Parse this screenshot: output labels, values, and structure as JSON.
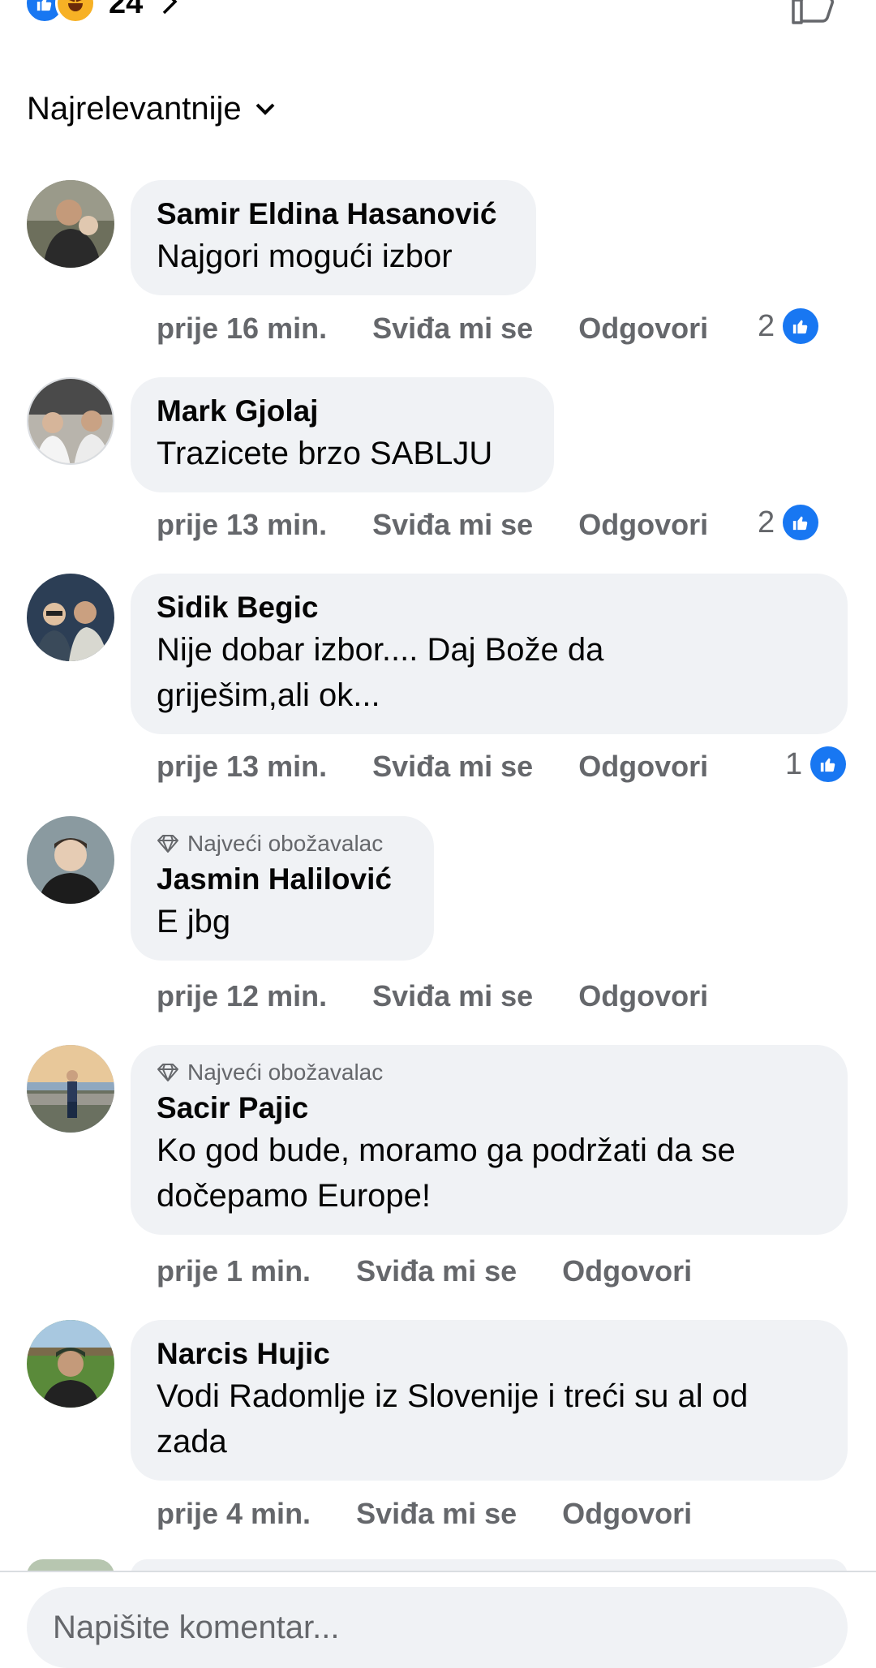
{
  "top": {
    "reaction_count": "24"
  },
  "sort": {
    "label": "Najrelevantnije"
  },
  "comments": [
    {
      "author": "Samir Eldina Hasanović",
      "text": "Najgori mogući izbor",
      "time": "prije 16 min.",
      "like_label": "Sviđa mi se",
      "reply_label": "Odgovori",
      "likes": "2",
      "badge": ""
    },
    {
      "author": "Mark Gjolaj",
      "text": "Trazicete brzo SABLJU",
      "time": "prije 13 min.",
      "like_label": "Sviđa mi se",
      "reply_label": "Odgovori",
      "likes": "2",
      "badge": ""
    },
    {
      "author": "Sidik Begic",
      "text": "Nije dobar izbor.... Daj Bože da griješim,ali ok...",
      "time": "prije 13 min.",
      "like_label": "Sviđa mi se",
      "reply_label": "Odgovori",
      "likes": "1",
      "badge": ""
    },
    {
      "author": "Jasmin Halilović",
      "text": "E jbg",
      "time": "prije 12 min.",
      "like_label": "Sviđa mi se",
      "reply_label": "Odgovori",
      "likes": "",
      "badge": "Najveći obožavalac"
    },
    {
      "author": "Sacir Pajic",
      "text": "Ko god bude, moramo ga podržati da se dočepamo Europe!",
      "time": "prije 1 min.",
      "like_label": "Sviđa mi se",
      "reply_label": "Odgovori",
      "likes": "",
      "badge": "Najveći obožavalac"
    },
    {
      "author": "Narcis Hujic",
      "text": "Vodi Radomlje iz Slovenije i treći su al od zada",
      "time": "prije 4 min.",
      "like_label": "Sviđa mi se",
      "reply_label": "Odgovori",
      "likes": "",
      "badge": ""
    }
  ],
  "composer": {
    "placeholder": "Napišite komentar..."
  },
  "colors": {
    "accent": "#1877f2",
    "bubble": "#f0f2f5",
    "meta": "#65676b"
  },
  "icons": [
    "like-icon",
    "haha-icon",
    "chevron-right-icon",
    "like-outline-icon",
    "chevron-down-icon",
    "diamond-icon"
  ]
}
